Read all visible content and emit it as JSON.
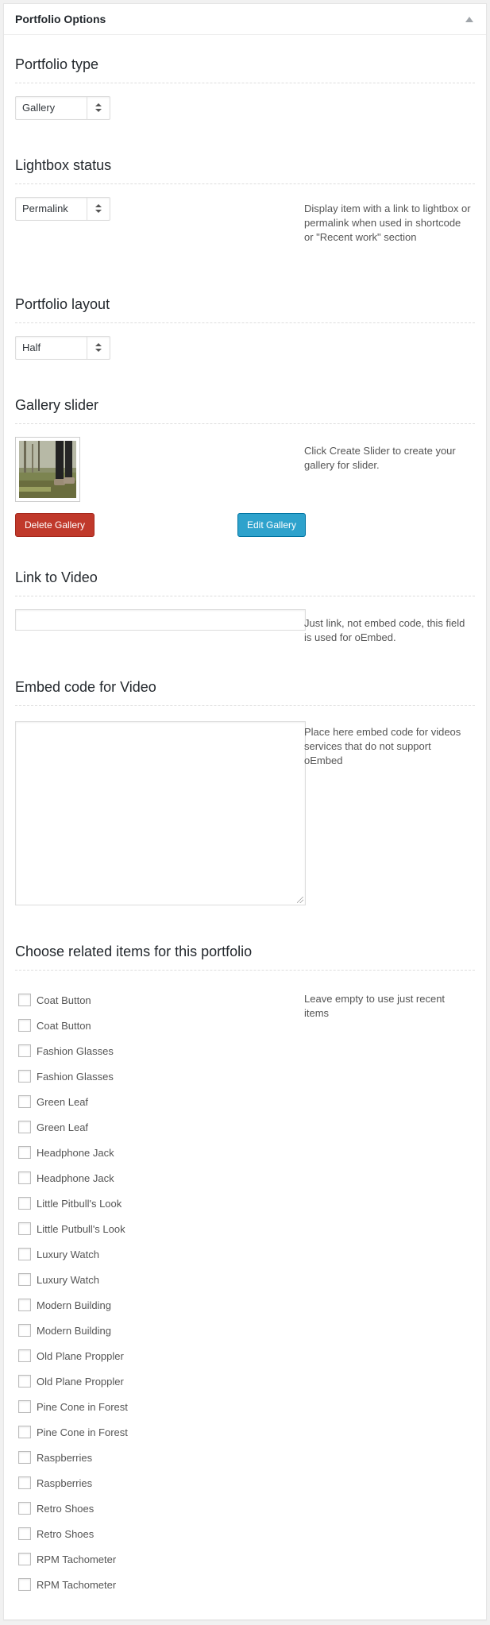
{
  "postbox": {
    "title": "Portfolio Options"
  },
  "sections": {
    "portfolio_type": {
      "title": "Portfolio type",
      "selected": "Gallery"
    },
    "lightbox_status": {
      "title": "Lightbox status",
      "selected": "Permalink",
      "description": "Display item with a link to lightbox or permalink when used in shortcode or \"Recent work\" section"
    },
    "portfolio_layout": {
      "title": "Portfolio layout",
      "selected": "Half"
    },
    "gallery_slider": {
      "title": "Gallery slider",
      "description": "Click Create Slider to create your gallery for slider.",
      "delete_label": "Delete Gallery",
      "edit_label": "Edit Gallery"
    },
    "link_to_video": {
      "title": "Link to Video",
      "value": "",
      "description": "Just link, not embed code, this field is used for oEmbed."
    },
    "embed_code": {
      "title": "Embed code for Video",
      "value": "",
      "description": "Place here embed code for videos services that do not support oEmbed"
    },
    "related_items": {
      "title": "Choose related items for this portfolio",
      "description": "Leave empty to use just recent items",
      "items": [
        "Coat Button",
        "Coat Button",
        "Fashion Glasses",
        "Fashion Glasses",
        "Green Leaf",
        "Green Leaf",
        "Headphone Jack",
        "Headphone Jack",
        "Little Pitbull's Look",
        "Little Putbull's Look",
        "Luxury Watch",
        "Luxury Watch",
        "Modern Building",
        "Modern Building",
        "Old Plane Proppler",
        "Old Plane Proppler",
        "Pine Cone in Forest",
        "Pine Cone in Forest",
        "Raspberries",
        "Raspberries",
        "Retro Shoes",
        "Retro Shoes",
        "RPM Tachometer",
        "RPM Tachometer"
      ]
    }
  },
  "colors": {
    "delete_button": "#c0392b",
    "edit_button": "#2ea2cc"
  }
}
